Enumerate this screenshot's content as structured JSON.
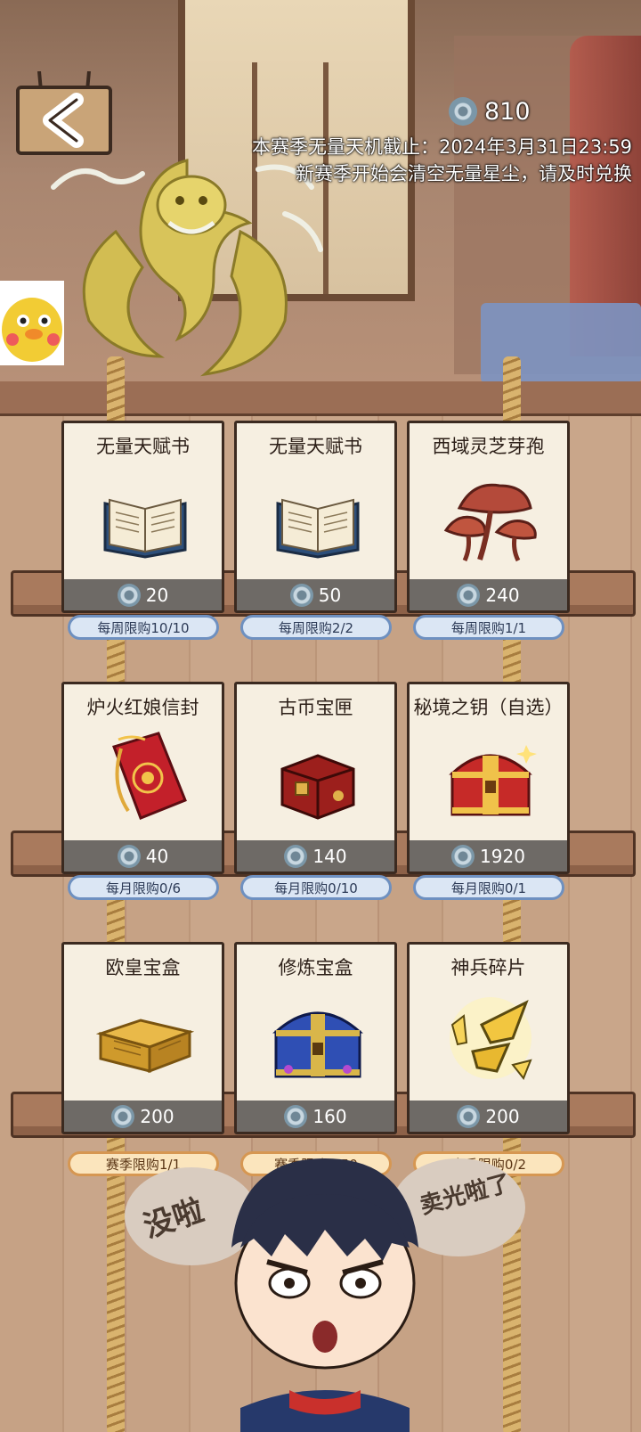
{
  "header": {
    "currency_amount": "810",
    "currency_icon": "star-dust-coin-icon",
    "notice_line1": "本赛季无量天机截止：2024年3月31日23:59",
    "notice_line2": "新赛季开始会清空无量星尘，请及时兑换"
  },
  "shop": {
    "items": [
      {
        "name": "无量天赋书",
        "icon": "open-book-icon",
        "price": "20",
        "limit": "每周限购10/10",
        "limit_style": "blue"
      },
      {
        "name": "无量天赋书",
        "icon": "open-book-icon",
        "price": "50",
        "limit": "每周限购2/2",
        "limit_style": "blue"
      },
      {
        "name": "西域灵芝芽孢",
        "icon": "lingzhi-mushroom-icon",
        "price": "240",
        "limit": "每周限购1/1",
        "limit_style": "blue"
      },
      {
        "name": "炉火红娘信封",
        "icon": "red-envelope-icon",
        "price": "40",
        "limit": "每月限购0/6",
        "limit_style": "blue"
      },
      {
        "name": "古币宝匣",
        "icon": "red-coin-box-icon",
        "price": "140",
        "limit": "每月限购0/10",
        "limit_style": "blue"
      },
      {
        "name": "秘境之钥（自选）",
        "icon": "red-gold-chest-icon",
        "price": "1920",
        "limit": "每月限购0/1",
        "limit_style": "blue"
      },
      {
        "name": "欧皇宝盒",
        "icon": "golden-box-icon",
        "price": "200",
        "limit": "赛季限购1/1",
        "limit_style": "gold"
      },
      {
        "name": "修炼宝盒",
        "icon": "blue-treasure-chest-icon",
        "price": "160",
        "limit": "赛季限购0/50",
        "limit_style": "gold"
      },
      {
        "name": "神兵碎片",
        "icon": "weapon-shard-icon",
        "price": "200",
        "limit": "赛季限购0/2",
        "limit_style": "gold"
      }
    ]
  },
  "footer": {
    "bubble_left": "没啦",
    "bubble_right": "卖光啦了"
  },
  "colors": {
    "card_bg": "#f6efe1",
    "price_bar": "#6e6a66",
    "limit_blue": "#6e90c0",
    "limit_gold": "#d69752",
    "shelf": "#a97a5d"
  }
}
